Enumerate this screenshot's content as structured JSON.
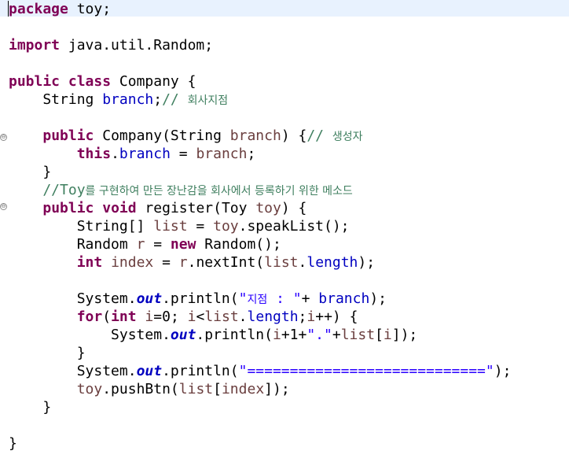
{
  "editor": {
    "language": "java",
    "lines": [
      [
        {
          "t": "package",
          "c": "kw"
        },
        {
          "t": " toy;"
        }
      ],
      [],
      [
        {
          "t": "import",
          "c": "kw"
        },
        {
          "t": " java.util.Random;"
        }
      ],
      [],
      [
        {
          "t": "public",
          "c": "kw"
        },
        {
          "t": " "
        },
        {
          "t": "class",
          "c": "kw"
        },
        {
          "t": " Company {"
        }
      ],
      [
        {
          "t": "    String "
        },
        {
          "t": "branch",
          "c": "fld"
        },
        {
          "t": ";"
        },
        {
          "t": "// ",
          "c": "cmt"
        },
        {
          "t": "회사지점",
          "c": "cmt-ko"
        }
      ],
      [],
      [
        {
          "t": "    "
        },
        {
          "t": "public",
          "c": "kw"
        },
        {
          "t": " Company(String "
        },
        {
          "t": "branch",
          "c": "var"
        },
        {
          "t": ") {"
        },
        {
          "t": "// ",
          "c": "cmt"
        },
        {
          "t": "생성자",
          "c": "cmt-ko"
        }
      ],
      [
        {
          "t": "        "
        },
        {
          "t": "this",
          "c": "kw"
        },
        {
          "t": "."
        },
        {
          "t": "branch",
          "c": "fld"
        },
        {
          "t": " = "
        },
        {
          "t": "branch",
          "c": "var"
        },
        {
          "t": ";"
        }
      ],
      [
        {
          "t": "    }"
        }
      ],
      [
        {
          "t": "    //Toy",
          "c": "cmt"
        },
        {
          "t": "를 구현하여 만든 장난감을 회사에서 등록하기 위한 메소드",
          "c": "cmt-ko"
        }
      ],
      [
        {
          "t": "    "
        },
        {
          "t": "public",
          "c": "kw"
        },
        {
          "t": " "
        },
        {
          "t": "void",
          "c": "kw"
        },
        {
          "t": " register(Toy "
        },
        {
          "t": "toy",
          "c": "var"
        },
        {
          "t": ") {"
        }
      ],
      [
        {
          "t": "        String[] "
        },
        {
          "t": "list",
          "c": "var"
        },
        {
          "t": " = "
        },
        {
          "t": "toy",
          "c": "var"
        },
        {
          "t": ".speakList();"
        }
      ],
      [
        {
          "t": "        Random "
        },
        {
          "t": "r",
          "c": "var"
        },
        {
          "t": " = "
        },
        {
          "t": "new",
          "c": "kw"
        },
        {
          "t": " Random();"
        }
      ],
      [
        {
          "t": "        "
        },
        {
          "t": "int",
          "c": "kw"
        },
        {
          "t": " "
        },
        {
          "t": "index",
          "c": "var"
        },
        {
          "t": " = "
        },
        {
          "t": "r",
          "c": "var"
        },
        {
          "t": ".nextInt("
        },
        {
          "t": "list",
          "c": "var"
        },
        {
          "t": "."
        },
        {
          "t": "length",
          "c": "fld"
        },
        {
          "t": ");"
        }
      ],
      [],
      [
        {
          "t": "        System."
        },
        {
          "t": "out",
          "c": "sfld"
        },
        {
          "t": ".println("
        },
        {
          "t": "\"",
          "c": "str"
        },
        {
          "t": "지점",
          "c": "str-ko"
        },
        {
          "t": " : \"",
          "c": "str"
        },
        {
          "t": "+ "
        },
        {
          "t": "branch",
          "c": "fld"
        },
        {
          "t": ");"
        }
      ],
      [
        {
          "t": "        "
        },
        {
          "t": "for",
          "c": "kw"
        },
        {
          "t": "("
        },
        {
          "t": "int",
          "c": "kw"
        },
        {
          "t": " "
        },
        {
          "t": "i",
          "c": "var"
        },
        {
          "t": "=0; "
        },
        {
          "t": "i",
          "c": "var"
        },
        {
          "t": "<"
        },
        {
          "t": "list",
          "c": "var"
        },
        {
          "t": "."
        },
        {
          "t": "length",
          "c": "fld"
        },
        {
          "t": ";"
        },
        {
          "t": "i",
          "c": "var"
        },
        {
          "t": "++) {"
        }
      ],
      [
        {
          "t": "            System."
        },
        {
          "t": "out",
          "c": "sfld"
        },
        {
          "t": ".println("
        },
        {
          "t": "i",
          "c": "var"
        },
        {
          "t": "+1+"
        },
        {
          "t": "\".\"",
          "c": "str"
        },
        {
          "t": "+"
        },
        {
          "t": "list",
          "c": "var"
        },
        {
          "t": "["
        },
        {
          "t": "i",
          "c": "var"
        },
        {
          "t": "]);"
        }
      ],
      [
        {
          "t": "        }"
        }
      ],
      [
        {
          "t": "        System."
        },
        {
          "t": "out",
          "c": "sfld"
        },
        {
          "t": ".println("
        },
        {
          "t": "\"============================\"",
          "c": "str"
        },
        {
          "t": ");"
        }
      ],
      [
        {
          "t": "        "
        },
        {
          "t": "toy",
          "c": "var"
        },
        {
          "t": ".pushBtn("
        },
        {
          "t": "list",
          "c": "var"
        },
        {
          "t": "["
        },
        {
          "t": "index",
          "c": "var"
        },
        {
          "t": "]);"
        }
      ],
      [
        {
          "t": "    }"
        }
      ],
      [],
      [
        {
          "t": "}"
        }
      ]
    ],
    "fold_markers": [
      "⊖",
      "⊖"
    ],
    "colors": {
      "keyword": "#7f0055",
      "field": "#0000c0",
      "string": "#2a00ff",
      "comment": "#3f7f5f",
      "local_variable": "#6a3e3e",
      "current_line": "#e8f2fe"
    }
  }
}
